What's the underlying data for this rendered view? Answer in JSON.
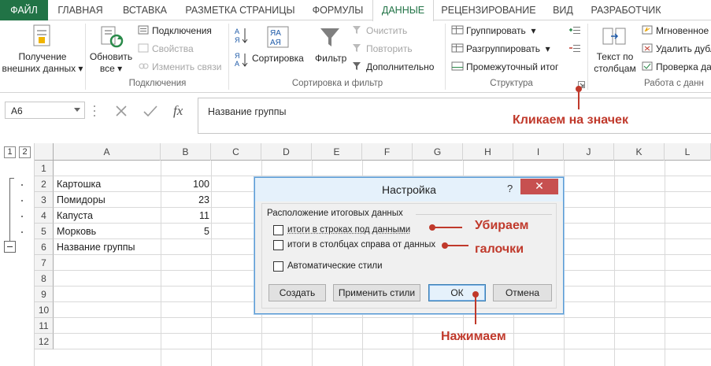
{
  "tabs": [
    {
      "label": "ФАЙЛ"
    },
    {
      "label": "ГЛАВНАЯ"
    },
    {
      "label": "ВСТАВКА"
    },
    {
      "label": "РАЗМЕТКА СТРАНИЦЫ"
    },
    {
      "label": "ФОРМУЛЫ"
    },
    {
      "label": "ДАННЫЕ"
    },
    {
      "label": "РЕЦЕНЗИРОВАНИЕ"
    },
    {
      "label": "ВИД"
    },
    {
      "label": "РАЗРАБОТЧИК"
    }
  ],
  "ribbon": {
    "get_external": {
      "line1": "Получение",
      "line2": "внешних данных"
    },
    "connections": {
      "refresh_line1": "Обновить",
      "refresh_line2": "все",
      "connections": "Подключения",
      "properties": "Свойства",
      "edit_links": "Изменить связи",
      "group_label": "Подключения"
    },
    "sort_filter": {
      "sort": "Сортировка",
      "filter": "Фильтр",
      "clear": "Очистить",
      "reapply": "Повторить",
      "advanced": "Дополнительно",
      "group_label": "Сортировка и фильтр"
    },
    "outline": {
      "group": "Группировать",
      "ungroup": "Разгруппировать",
      "subtotal": "Промежуточный итог",
      "group_label": "Структура"
    },
    "data_tools": {
      "text_line1": "Текст по",
      "text_line2": "столбцам",
      "flash_fill": "Мгновенное",
      "remove_dup": "Удалить дубл",
      "validation": "Проверка да",
      "group_label": "Работа с данн"
    }
  },
  "formula_bar": {
    "name_box": "A6",
    "formula": "Название группы"
  },
  "grid": {
    "outline_levels": [
      "1",
      "2"
    ],
    "columns": [
      "A",
      "B",
      "C",
      "D",
      "E",
      "F",
      "G",
      "H",
      "I",
      "J",
      "K",
      "L"
    ],
    "rows": [
      "1",
      "2",
      "3",
      "4",
      "5",
      "6",
      "7",
      "8",
      "9",
      "10",
      "11",
      "12"
    ],
    "cells": [
      {
        "row": 2,
        "a": "Картошка",
        "b": "100"
      },
      {
        "row": 3,
        "a": "Помидоры",
        "b": "23"
      },
      {
        "row": 4,
        "a": "Капуста",
        "b": "11"
      },
      {
        "row": 5,
        "a": "Морковь",
        "b": "5"
      },
      {
        "row": 6,
        "a": "Название группы",
        "b": ""
      }
    ]
  },
  "dialog": {
    "title": "Настройка",
    "help": "?",
    "close": "✕",
    "legend": "Расположение итоговых данных",
    "cb_rows": {
      "label": "итоги в строках под данными",
      "checked": false
    },
    "cb_cols": {
      "label": "итоги в столбцах справа от данных",
      "checked": false
    },
    "cb_auto": {
      "label": "Автоматические стили",
      "checked": false
    },
    "btn_create": "Создать",
    "btn_apply": "Применить стили",
    "btn_ok": "ОК",
    "btn_cancel": "Отмена"
  },
  "annotations": {
    "click_icon": "Кликаем на значек",
    "remove_line1": "Убираем",
    "remove_line2": "галочки",
    "press": "Нажимаем",
    "color": "#c0392b"
  }
}
